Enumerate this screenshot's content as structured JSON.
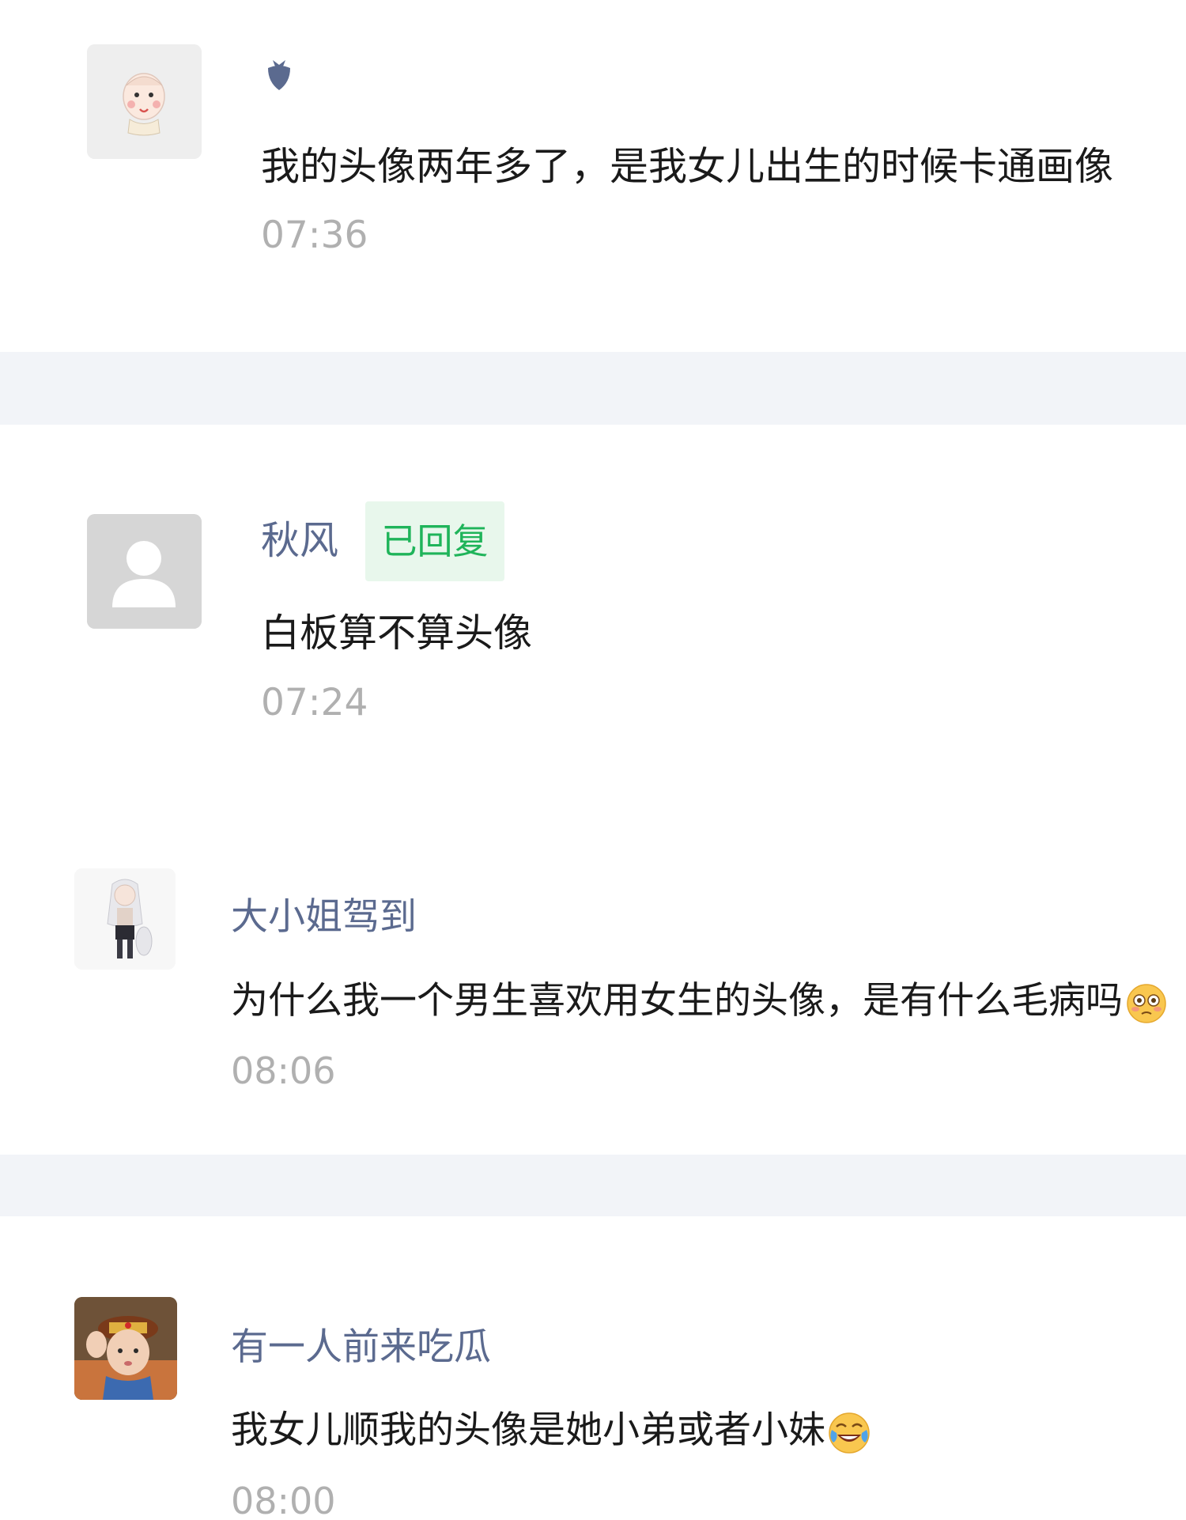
{
  "comments": [
    {
      "name": "",
      "name_icon": "strawberry-icon",
      "text": "我的头像两年多了，是我女儿出生的时候卡通画像",
      "time": "07:36",
      "avatar": "cartoon-baby-avatar"
    },
    {
      "name": "秋风",
      "badge": "已回复",
      "text": "白板算不算头像",
      "time": "07:24",
      "avatar": "default-person-avatar"
    },
    {
      "name": "大小姐驾到",
      "text": "为什么我一个男生喜欢用女生的头像，是有什么毛病吗",
      "emoji": "flushed-face-emoji",
      "time": "08:06",
      "avatar": "anime-girl-avatar"
    },
    {
      "name": "有一人前来吃瓜",
      "text": "我女儿顺我的头像是她小弟或者小妹",
      "emoji": "rolling-laughing-face-emoji",
      "time": "08:00",
      "avatar": "boy-in-cap-avatar"
    }
  ],
  "colors": {
    "name": "#5b6a8f",
    "text": "#1a1a1a",
    "time": "#b0b0b0",
    "badge_bg": "#e8f7ec",
    "badge_text": "#1fb45a",
    "divider": "#f2f4f8"
  }
}
